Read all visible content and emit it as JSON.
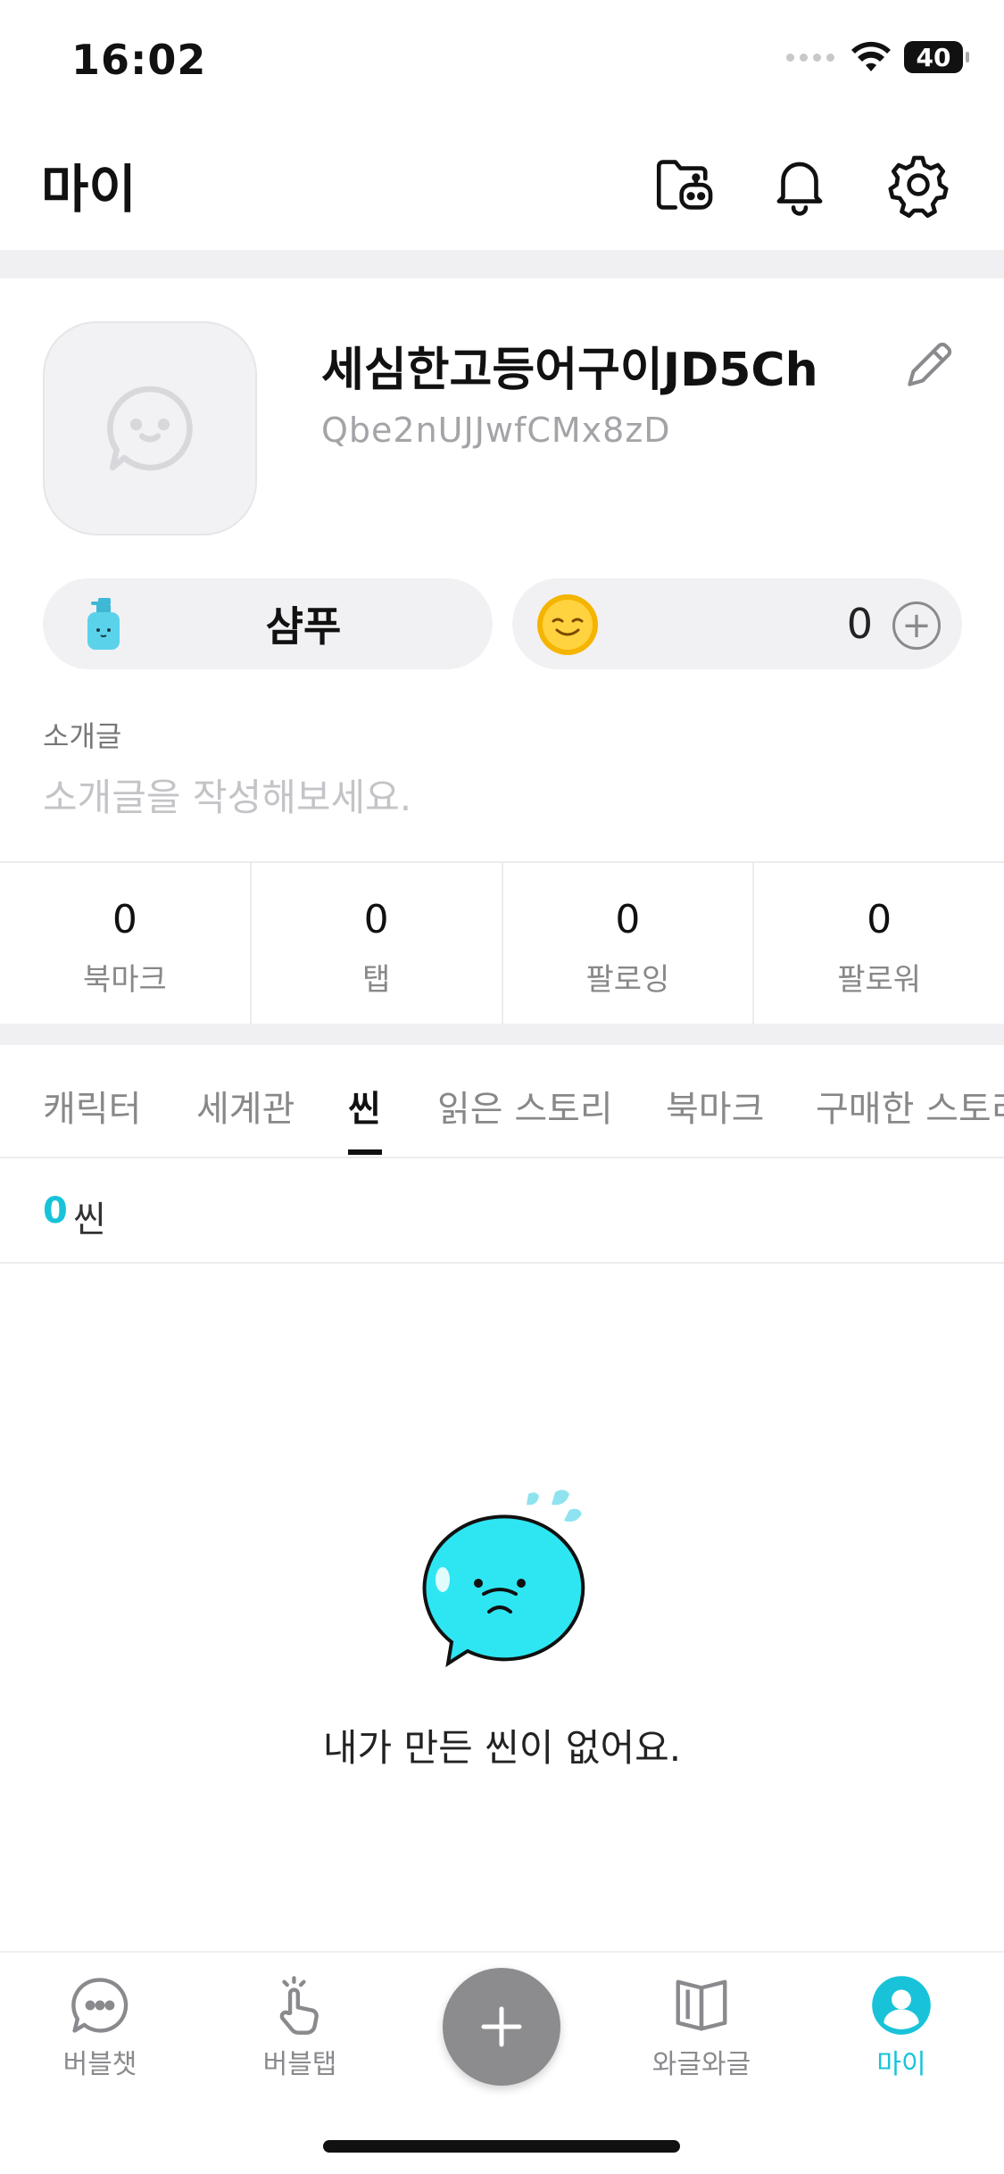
{
  "status_bar": {
    "time": "16:02",
    "battery": "40"
  },
  "header": {
    "title": "마이"
  },
  "profile": {
    "name": "세심한고등어구이JD5Ch",
    "id": "Qbe2nUJJwfCMx8zD",
    "shampoo_label": "샴푸",
    "coin_count": "0",
    "coin_add": "+",
    "intro_label": "소개글",
    "intro_placeholder": "소개글을 작성해보세요."
  },
  "stats": [
    {
      "value": "0",
      "label": "북마크"
    },
    {
      "value": "0",
      "label": "탭"
    },
    {
      "value": "0",
      "label": "팔로잉"
    },
    {
      "value": "0",
      "label": "팔로워"
    }
  ],
  "tabs": [
    {
      "label": "캐릭터"
    },
    {
      "label": "세계관"
    },
    {
      "label": "씬"
    },
    {
      "label": "읽은 스토리"
    },
    {
      "label": "북마크"
    },
    {
      "label": "구매한 스토리"
    }
  ],
  "active_tab": "씬",
  "content": {
    "count": "0",
    "count_unit": "씬",
    "empty_message": "내가 만든 씬이 없어요."
  },
  "bottom_nav": [
    {
      "label": "버블챗",
      "icon": "chat-bubble-icon"
    },
    {
      "label": "버블탭",
      "icon": "tap-hand-icon"
    },
    {
      "label": "와글와글",
      "icon": "book-icon"
    },
    {
      "label": "마이",
      "icon": "profile-icon"
    }
  ],
  "colors": {
    "accent": "#18c3d9",
    "fab": "#8c8c8e",
    "band": "#f0f0f2"
  }
}
